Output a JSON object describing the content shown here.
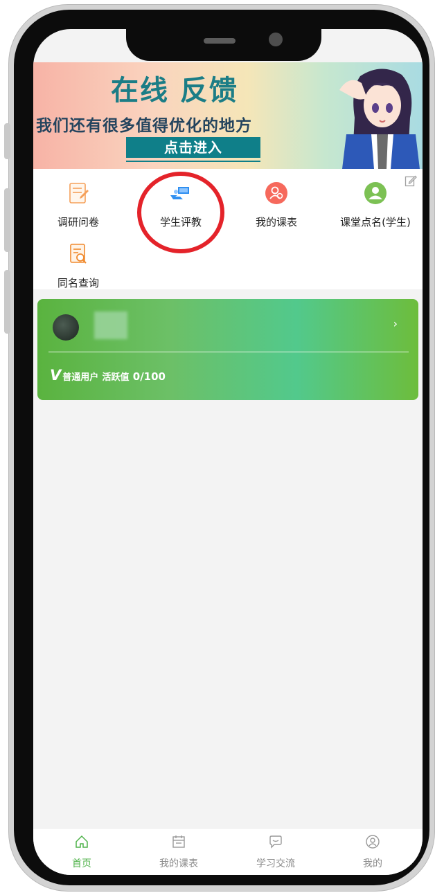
{
  "banner": {
    "title": "在线 反馈",
    "subtitle": "我们还有很多值得优化的地方",
    "button_label": "点击进入"
  },
  "grid": {
    "items": [
      {
        "label": "调研问卷",
        "icon": "survey-icon",
        "color": "#f5a05a"
      },
      {
        "label": "学生评教",
        "icon": "student-evaluation-icon",
        "color": "#2f8ff0"
      },
      {
        "label": "我的课表",
        "icon": "my-schedule-icon",
        "color": "#f6695c"
      },
      {
        "label": "课堂点名(学生)",
        "icon": "roll-call-icon",
        "color": "#7cc154"
      },
      {
        "label": "同名查询",
        "icon": "name-search-icon",
        "color": "#f08a2e"
      }
    ]
  },
  "user_card": {
    "v_badge": "V",
    "user_type": "普通用户",
    "activity_label": "活跃值",
    "activity_value": "0/100",
    "arrow": "›"
  },
  "tabbar": {
    "items": [
      {
        "label": "首页",
        "icon": "home-icon",
        "active": true
      },
      {
        "label": "我的课表",
        "icon": "calendar-icon",
        "active": false
      },
      {
        "label": "学习交流",
        "icon": "chat-icon",
        "active": false
      },
      {
        "label": "我的",
        "icon": "profile-icon",
        "active": false
      }
    ]
  },
  "colors": {
    "accent": "#4fb24a",
    "highlight": "#e4232a",
    "banner_teal": "#0f7f89"
  }
}
